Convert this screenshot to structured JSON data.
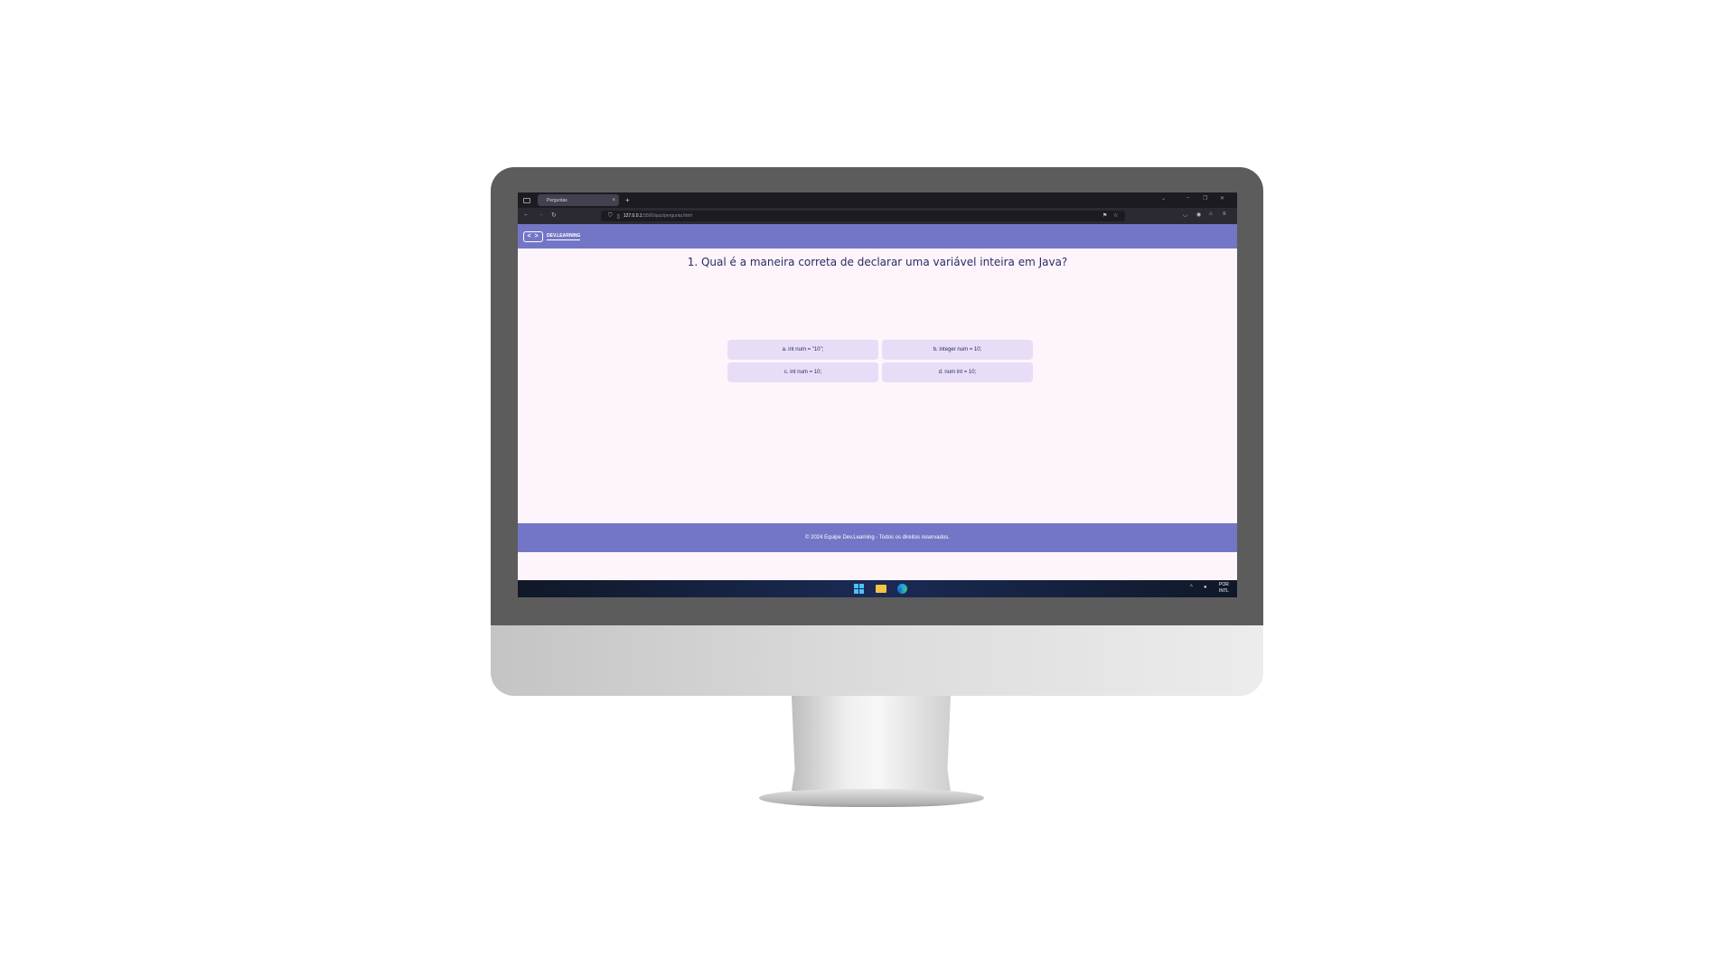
{
  "browser": {
    "tab_title": "Perguntas",
    "tab_close": "×",
    "new_tab": "+",
    "url_host": "127.0.0.1",
    "url_path": ":5500/quiz/pergunta.html"
  },
  "site": {
    "logo_glyph": "< >",
    "logo_text": "DEV.LEARNING"
  },
  "quiz": {
    "question": "1. Qual é a maneira correta de declarar uma variável inteira em Java?",
    "options": [
      "a. int num = \"10\";",
      "b. integer num = 10;",
      "c. int num = 10;",
      "d.  num int = 10;"
    ]
  },
  "footer": {
    "text": "© 2024 Equipe Dev.Learning - Todos os direitos reservados."
  },
  "taskbar": {
    "lang_line1": "POR",
    "lang_line2": "INTL"
  },
  "colors": {
    "header_bg": "#7376c6",
    "page_bg": "#fdf5fb",
    "option_bg": "#e7ddf6",
    "question_text": "#2a2a66"
  },
  "icons": [
    "tab-list-icon",
    "close-icon",
    "back-icon",
    "forward-icon",
    "reload-icon",
    "shield-icon",
    "page-icon",
    "translate-icon",
    "star-icon",
    "pocket-icon",
    "account-icon",
    "extensions-icon",
    "menu-icon",
    "windows-start-icon",
    "file-explorer-icon",
    "edge-icon",
    "chevron-up-icon",
    "microphone-icon"
  ]
}
